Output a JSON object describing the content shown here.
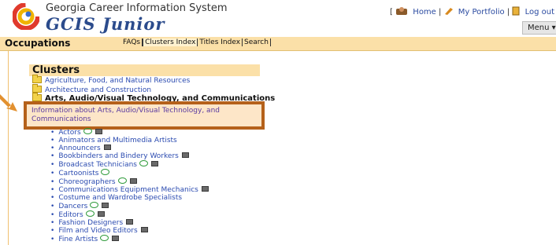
{
  "header": {
    "site_title": "Georgia Career Information System",
    "site_subtitle": "GCIS Junior",
    "bracket_open": "[",
    "home_label": "Home",
    "portfolio_label": "My Portfolio",
    "logout_label": "Log out",
    "separator": "|",
    "menu_label": "Menu ▾"
  },
  "navbar": {
    "title": "Occupations",
    "links": [
      "FAQs",
      "Clusters Index",
      "Titles Index",
      "Search"
    ],
    "active_index": 1
  },
  "clusters": {
    "title": "Clusters",
    "folders": [
      "Agriculture, Food, and Natural Resources",
      "Architecture and Construction"
    ],
    "open_cluster": "Arts, Audio/Visual Technology, and Communications",
    "info_link": "Information about Arts, Audio/Visual Technology, and Communications"
  },
  "occupations": [
    {
      "name": "Actors",
      "bubble": true,
      "film": true
    },
    {
      "name": "Animators and Multimedia Artists",
      "bubble": false,
      "film": false
    },
    {
      "name": "Announcers",
      "bubble": false,
      "film": true
    },
    {
      "name": "Bookbinders and Bindery Workers",
      "bubble": false,
      "film": true
    },
    {
      "name": "Broadcast Technicians",
      "bubble": true,
      "film": true
    },
    {
      "name": "Cartoonists",
      "bubble": true,
      "film": false
    },
    {
      "name": "Choreographers",
      "bubble": true,
      "film": true
    },
    {
      "name": "Communications Equipment Mechanics",
      "bubble": false,
      "film": true
    },
    {
      "name": "Costume and Wardrobe Specialists",
      "bubble": false,
      "film": false
    },
    {
      "name": "Dancers",
      "bubble": true,
      "film": true
    },
    {
      "name": "Editors",
      "bubble": true,
      "film": true
    },
    {
      "name": "Fashion Designers",
      "bubble": false,
      "film": true
    },
    {
      "name": "Film and Video Editors",
      "bubble": false,
      "film": true
    },
    {
      "name": "Fine Artists",
      "bubble": true,
      "film": true
    }
  ],
  "colors": {
    "navbar_bg": "#fbe0a8",
    "highlight_border": "#b5611a",
    "link": "#2b4bb0"
  }
}
